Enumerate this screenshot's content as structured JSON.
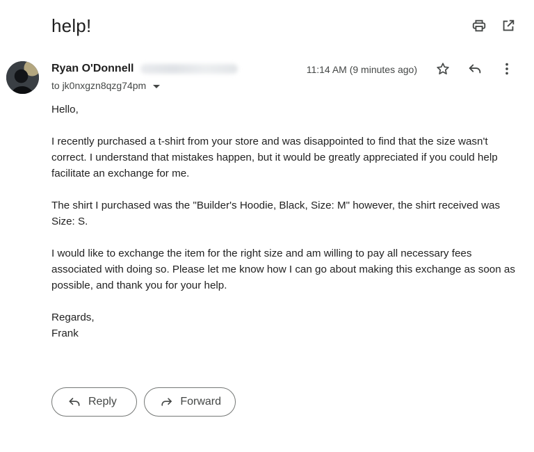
{
  "subject": "help!",
  "toolbar": {
    "print_icon": "print-icon",
    "open_new_window_icon": "open-in-new-icon"
  },
  "message": {
    "sender_name": "Ryan O'Donnell",
    "to_label": "to jk0nxgzn8qzg74pm",
    "timestamp": "11:14 AM (9 minutes ago)",
    "body": [
      "Hello,",
      "I recently purchased a t-shirt from your store and was disappointed to find that the size wasn't correct. I understand that mistakes happen, but it would be greatly appreciated if you could help facilitate an exchange for me.",
      "The shirt I purchased was the \"Builder's Hoodie, Black, Size: M\" however, the shirt received was Size: S.",
      "I would like to exchange the item for the right size and am willing to pay all necessary fees associated with doing so. Please let me know how I can go about making this exchange as soon as possible, and thank you for your help."
    ],
    "signoff": "Regards,",
    "signature": "Frank"
  },
  "actions": {
    "reply_label": "Reply",
    "forward_label": "Forward"
  }
}
